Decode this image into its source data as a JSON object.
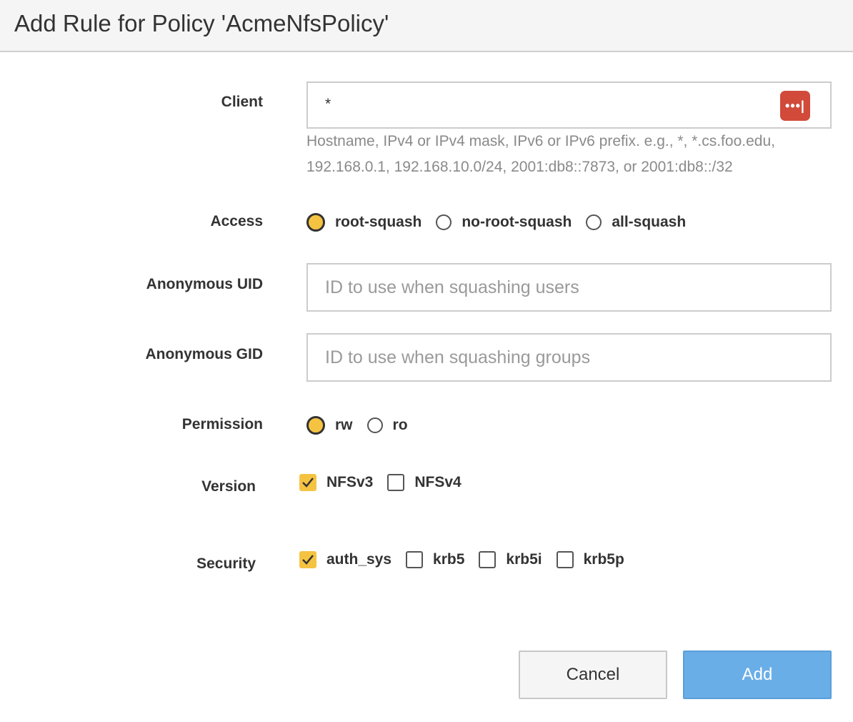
{
  "dialog": {
    "title": "Add Rule for Policy 'AcmeNfsPolicy'"
  },
  "client": {
    "label": "Client",
    "value": "*",
    "password_manager_icon": "lastpass-dots-icon",
    "password_manager_glyph": "•••|",
    "hint_line1": "Hostname, IPv4 or IPv4 mask, IPv6 or IPv6 prefix. e.g., *, *.cs.foo.edu,",
    "hint_line2": "192.168.0.1, 192.168.10.0/24, 2001:db8::7873, or 2001:db8::/32"
  },
  "access": {
    "label": "Access",
    "options": [
      "root-squash",
      "no-root-squash",
      "all-squash"
    ],
    "selected": "root-squash"
  },
  "anon_uid": {
    "label": "Anonymous UID",
    "placeholder": "ID to use when squashing users",
    "value": ""
  },
  "anon_gid": {
    "label": "Anonymous GID",
    "placeholder": "ID to use when squashing groups",
    "value": ""
  },
  "permission": {
    "label": "Permission",
    "options": [
      "rw",
      "ro"
    ],
    "selected": "rw"
  },
  "version": {
    "label": "Version",
    "options": [
      "NFSv3",
      "NFSv4"
    ],
    "checked": [
      true,
      false
    ]
  },
  "security": {
    "label": "Security",
    "options": [
      "auth_sys",
      "krb5",
      "krb5i",
      "krb5p"
    ],
    "checked": [
      true,
      false,
      false,
      false
    ]
  },
  "buttons": {
    "cancel": "Cancel",
    "add": "Add"
  },
  "colors": {
    "accent": "#f5c342",
    "primary_button": "#6aaee8",
    "password_icon": "#d14a3a"
  }
}
